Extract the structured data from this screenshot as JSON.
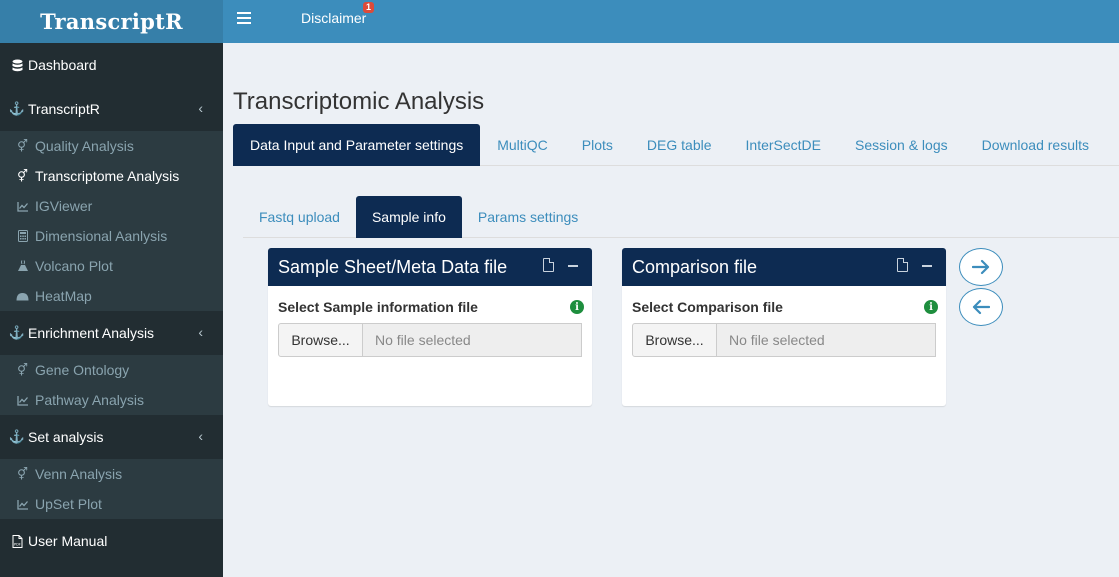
{
  "header": {
    "app_title": "TranscriptR",
    "disclaimer_label": "Disclaimer",
    "notification_count": "1"
  },
  "sidebar": {
    "items": [
      {
        "label": "Dashboard",
        "icon": "database-icon"
      },
      {
        "label": "TranscriptR",
        "icon": "anchor-icon",
        "sub": [
          {
            "label": "Quality Analysis",
            "icon": "venus-mars-icon"
          },
          {
            "label": "Transcriptome Analysis",
            "icon": "venus-mars-icon",
            "active": true
          },
          {
            "label": "IGViewer",
            "icon": "line-chart-icon"
          },
          {
            "label": "Dimensional Aanlysis",
            "icon": "calculator-icon"
          },
          {
            "label": "Volcano Plot",
            "icon": "volcano-icon"
          },
          {
            "label": "HeatMap",
            "icon": "heatmap-icon"
          }
        ]
      },
      {
        "label": "Enrichment Analysis",
        "icon": "anchor-icon",
        "sub": [
          {
            "label": "Gene Ontology",
            "icon": "venus-mars-icon"
          },
          {
            "label": "Pathway Analysis",
            "icon": "line-chart-icon"
          }
        ]
      },
      {
        "label": "Set analysis",
        "icon": "anchor-icon",
        "sub": [
          {
            "label": "Venn Analysis",
            "icon": "venus-mars-icon"
          },
          {
            "label": "UpSet Plot",
            "icon": "line-chart-icon"
          }
        ]
      },
      {
        "label": "User Manual",
        "icon": "pdf-icon"
      }
    ]
  },
  "main": {
    "page_title": "Transcriptomic Analysis",
    "tabs": [
      {
        "label": "Data Input and Parameter settings",
        "active": true
      },
      {
        "label": "MultiQC"
      },
      {
        "label": "Plots"
      },
      {
        "label": "DEG table"
      },
      {
        "label": "InterSectDE"
      },
      {
        "label": "Session & logs"
      },
      {
        "label": "Download results"
      }
    ],
    "subtabs": [
      {
        "label": "Fastq upload"
      },
      {
        "label": "Sample info",
        "active": true
      },
      {
        "label": "Params settings"
      }
    ],
    "boxes": [
      {
        "title": "Sample Sheet/Meta Data file",
        "field_label": "Select Sample information file",
        "browse_label": "Browse...",
        "file_placeholder": "No file selected"
      },
      {
        "title": "Comparison file",
        "field_label": "Select Comparison file",
        "browse_label": "Browse...",
        "file_placeholder": "No file selected"
      }
    ],
    "nav_buttons": {
      "next_icon": "arrow-right-icon",
      "prev_icon": "arrow-left-icon"
    }
  },
  "colors": {
    "header": "#3c8dbc",
    "logo_bg": "#367fa9",
    "sidebar": "#222d32",
    "sidebar_sub": "#2c3b41",
    "active_tab": "#0d2b52",
    "content_bg": "#ecf0f5",
    "info_green": "#1e8e3e",
    "badge_red": "#dd4b39"
  }
}
